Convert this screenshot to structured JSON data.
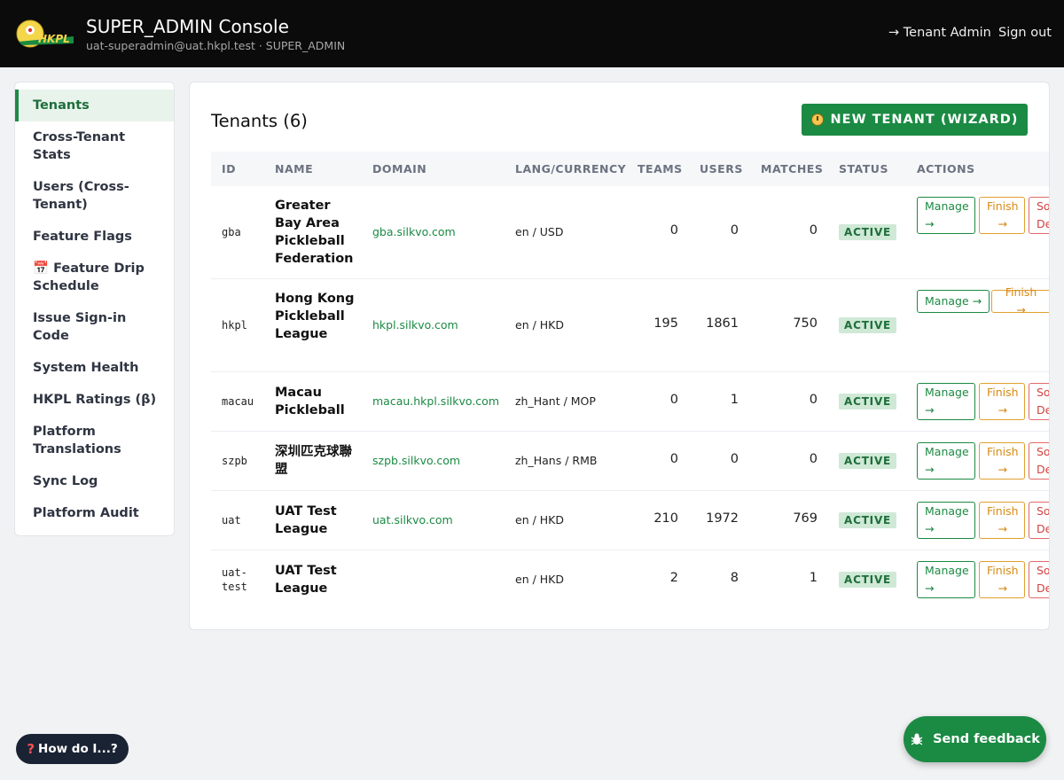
{
  "header": {
    "title": "SUPER_ADMIN Console",
    "subtitle": "uat-superadmin@uat.hkpl.test · SUPER_ADMIN",
    "logo_text": "HKPL",
    "tenant_admin_link": "→ Tenant Admin",
    "sign_out_link": "Sign out"
  },
  "sidebar": {
    "items": [
      {
        "label": "Tenants",
        "active": true
      },
      {
        "label": "Cross-Tenant Stats"
      },
      {
        "label": "Users (Cross-Tenant)"
      },
      {
        "label": "Feature Flags"
      },
      {
        "label": "📅 Feature Drip Schedule"
      },
      {
        "label": "Issue Sign-in Code"
      },
      {
        "label": "System Health"
      },
      {
        "label": "HKPL Ratings (β)"
      },
      {
        "label": "Platform Translations"
      },
      {
        "label": "Sync Log"
      },
      {
        "label": "Platform Audit"
      }
    ]
  },
  "main": {
    "title": "Tenants (6)",
    "new_tenant_button": "NEW TENANT (WIZARD)",
    "columns": [
      "ID",
      "NAME",
      "DOMAIN",
      "LANG/CURRENCY",
      "TEAMS",
      "USERS",
      "MATCHES",
      "STATUS",
      "ACTIONS"
    ],
    "rows": [
      {
        "id": "gba",
        "name": "Greater Bay Area Pickleball Federation",
        "domain": "gba.silkvo.com",
        "lang": "en / USD",
        "teams": "0",
        "users": "0",
        "matches": "0",
        "status": "ACTIVE",
        "manage": "Manage →",
        "finish": "Finish →",
        "delete": "Soft Delete"
      },
      {
        "id": "hkpl",
        "name": "Hong Kong Pickleball League",
        "domain": "hkpl.silkvo.com",
        "lang": "en / HKD",
        "teams": "195",
        "users": "1861",
        "matches": "750",
        "status": "ACTIVE",
        "manage": "Manage →",
        "finish": "Finish →"
      },
      {
        "id": "macau",
        "name": "Macau Pickleball",
        "domain": "macau.hkpl.silkvo.com",
        "lang": "zh_Hant / MOP",
        "teams": "0",
        "users": "1",
        "matches": "0",
        "status": "ACTIVE",
        "manage": "Manage →",
        "finish": "Finish →",
        "delete": "Soft Delete"
      },
      {
        "id": "szpb",
        "name": "深圳匹克球聯盟",
        "domain": "szpb.silkvo.com",
        "lang": "zh_Hans / RMB",
        "teams": "0",
        "users": "0",
        "matches": "0",
        "status": "ACTIVE",
        "manage": "Manage →",
        "finish": "Finish →",
        "delete": "Soft Delete"
      },
      {
        "id": "uat",
        "name": "UAT Test League",
        "domain": "uat.silkvo.com",
        "lang": "en / HKD",
        "teams": "210",
        "users": "1972",
        "matches": "769",
        "status": "ACTIVE",
        "manage": "Manage →",
        "finish": "Finish →",
        "delete": "Soft Delete"
      },
      {
        "id": "uat-test",
        "name": "UAT Test League",
        "domain": "",
        "lang": "en / HKD",
        "teams": "2",
        "users": "8",
        "matches": "1",
        "status": "ACTIVE",
        "manage": "Manage →",
        "finish": "Finish →",
        "delete": "Soft Delete"
      }
    ]
  },
  "help_button": {
    "icon": "question-icon",
    "label": "How do I...?"
  },
  "feedback_button": {
    "icon": "bug-icon",
    "label": "Send feedback"
  }
}
